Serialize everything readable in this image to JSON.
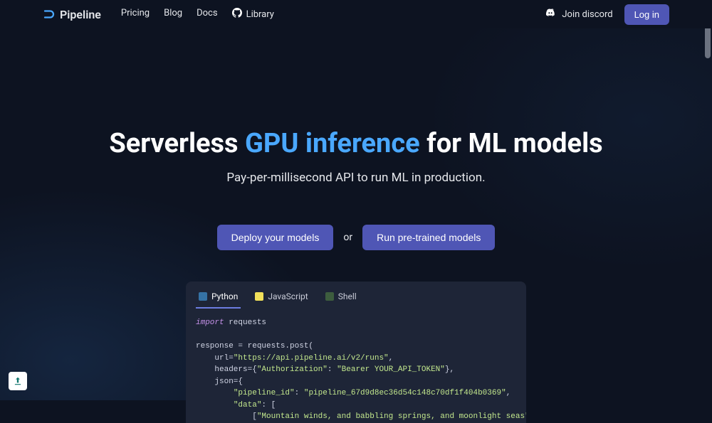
{
  "brand": "Pipeline",
  "nav": {
    "pricing": "Pricing",
    "blog": "Blog",
    "docs": "Docs",
    "library": "Library"
  },
  "discord": "Join discord",
  "login": "Log in",
  "hero": {
    "t1": "Serverless ",
    "t2": "GPU inference",
    "t3": " for ML models",
    "sub": "Pay-per-millisecond API to run ML in production.",
    "deploy": "Deploy your models",
    "or": "or",
    "run": "Run pre-trained models"
  },
  "tabs": {
    "python": "Python",
    "js": "JavaScript",
    "shell": "Shell"
  },
  "code": {
    "l1a": "import",
    "l1b": " requests",
    "l2": "response = requests.post(",
    "l3a": "    url=",
    "l3b": "\"https://api.pipeline.ai/v2/runs\"",
    "l3c": ",",
    "l4a": "    headers={",
    "l4b": "\"Authorization\"",
    "l4c": ": ",
    "l4d": "\"Bearer YOUR_API_TOKEN\"",
    "l4e": "},",
    "l5": "    json={",
    "l6a": "        ",
    "l6b": "\"pipeline_id\"",
    "l6c": ": ",
    "l6d": "\"pipeline_67d9d8ec36d54c148c70df1f404b0369\"",
    "l6e": ",",
    "l7a": "        ",
    "l7b": "\"data\"",
    "l7c": ": [",
    "l8a": "            [",
    "l8b": "\"Mountain winds, and babbling springs, and moonlight seas\"",
    "l8c": "],"
  }
}
